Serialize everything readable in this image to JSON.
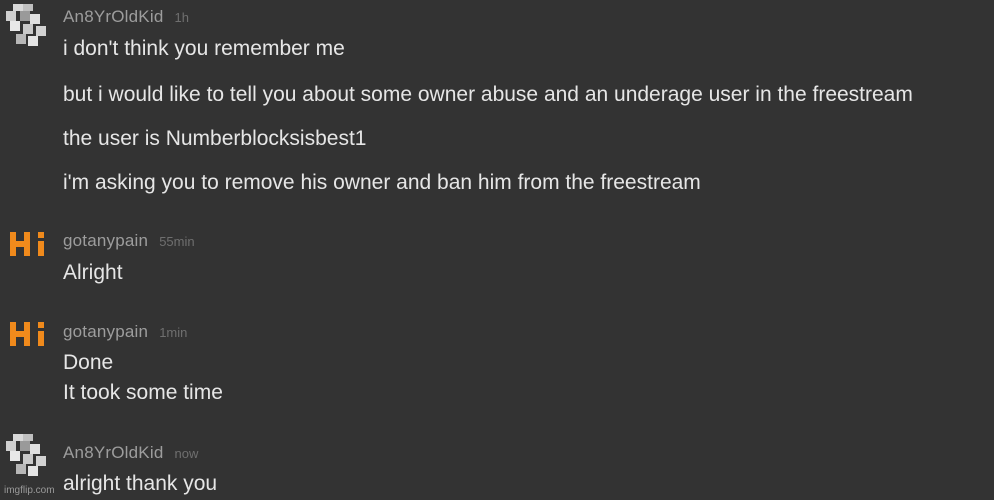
{
  "messages": [
    {
      "username": "An8YrOldKid",
      "time": "1h",
      "avatar_icon": "checker-avatar-icon",
      "lines": [
        "i don't think you remember me",
        "but i would like to tell you about some owner abuse and an underage user in the freestream",
        "the user is Numberblocksisbest1",
        "i'm asking you to remove his owner and ban him from the freestream"
      ]
    },
    {
      "username": "gotanypain",
      "time": "55min",
      "avatar_icon": "hi-logo-avatar-icon",
      "lines": [
        "Alright"
      ]
    },
    {
      "username": "gotanypain",
      "time": "1min",
      "avatar_icon": "hi-logo-avatar-icon",
      "lines": [
        "Done",
        "It took some time"
      ]
    },
    {
      "username": "An8YrOldKid",
      "time": "now",
      "avatar_icon": "checker-avatar-icon",
      "lines": [
        "alright thank you"
      ]
    }
  ],
  "colors": {
    "background": "#333333",
    "username": "#9d9d9d",
    "timestamp": "#6f6f6f",
    "message_text": "#e6e6e6",
    "hi_orange": "#f08a1c"
  },
  "watermark": "imgflip.com"
}
